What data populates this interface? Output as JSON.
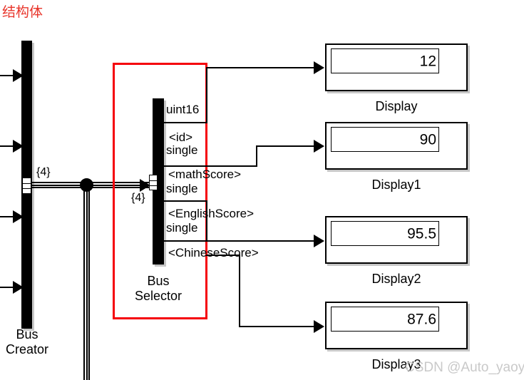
{
  "title": "结构体",
  "watermark": "CSDN @Auto_yaoyao",
  "bus_creator": {
    "label": "Bus\nCreator",
    "output_tag": "{4}",
    "input_count": 4
  },
  "bus_selector": {
    "label": "Bus\nSelector",
    "input_tag": "{4}",
    "highlight_color": "#f5000a",
    "port_labels": [
      "uint16",
      "<id>",
      "single",
      "<mathScore>",
      "single",
      "<EnglishScore>",
      "single",
      "<ChineseScore>"
    ]
  },
  "displays": [
    {
      "name": "Display",
      "value": "12"
    },
    {
      "name": "Display1",
      "value": "90"
    },
    {
      "name": "Display2",
      "value": "95.5"
    },
    {
      "name": "Display3",
      "value": "87.6"
    }
  ]
}
